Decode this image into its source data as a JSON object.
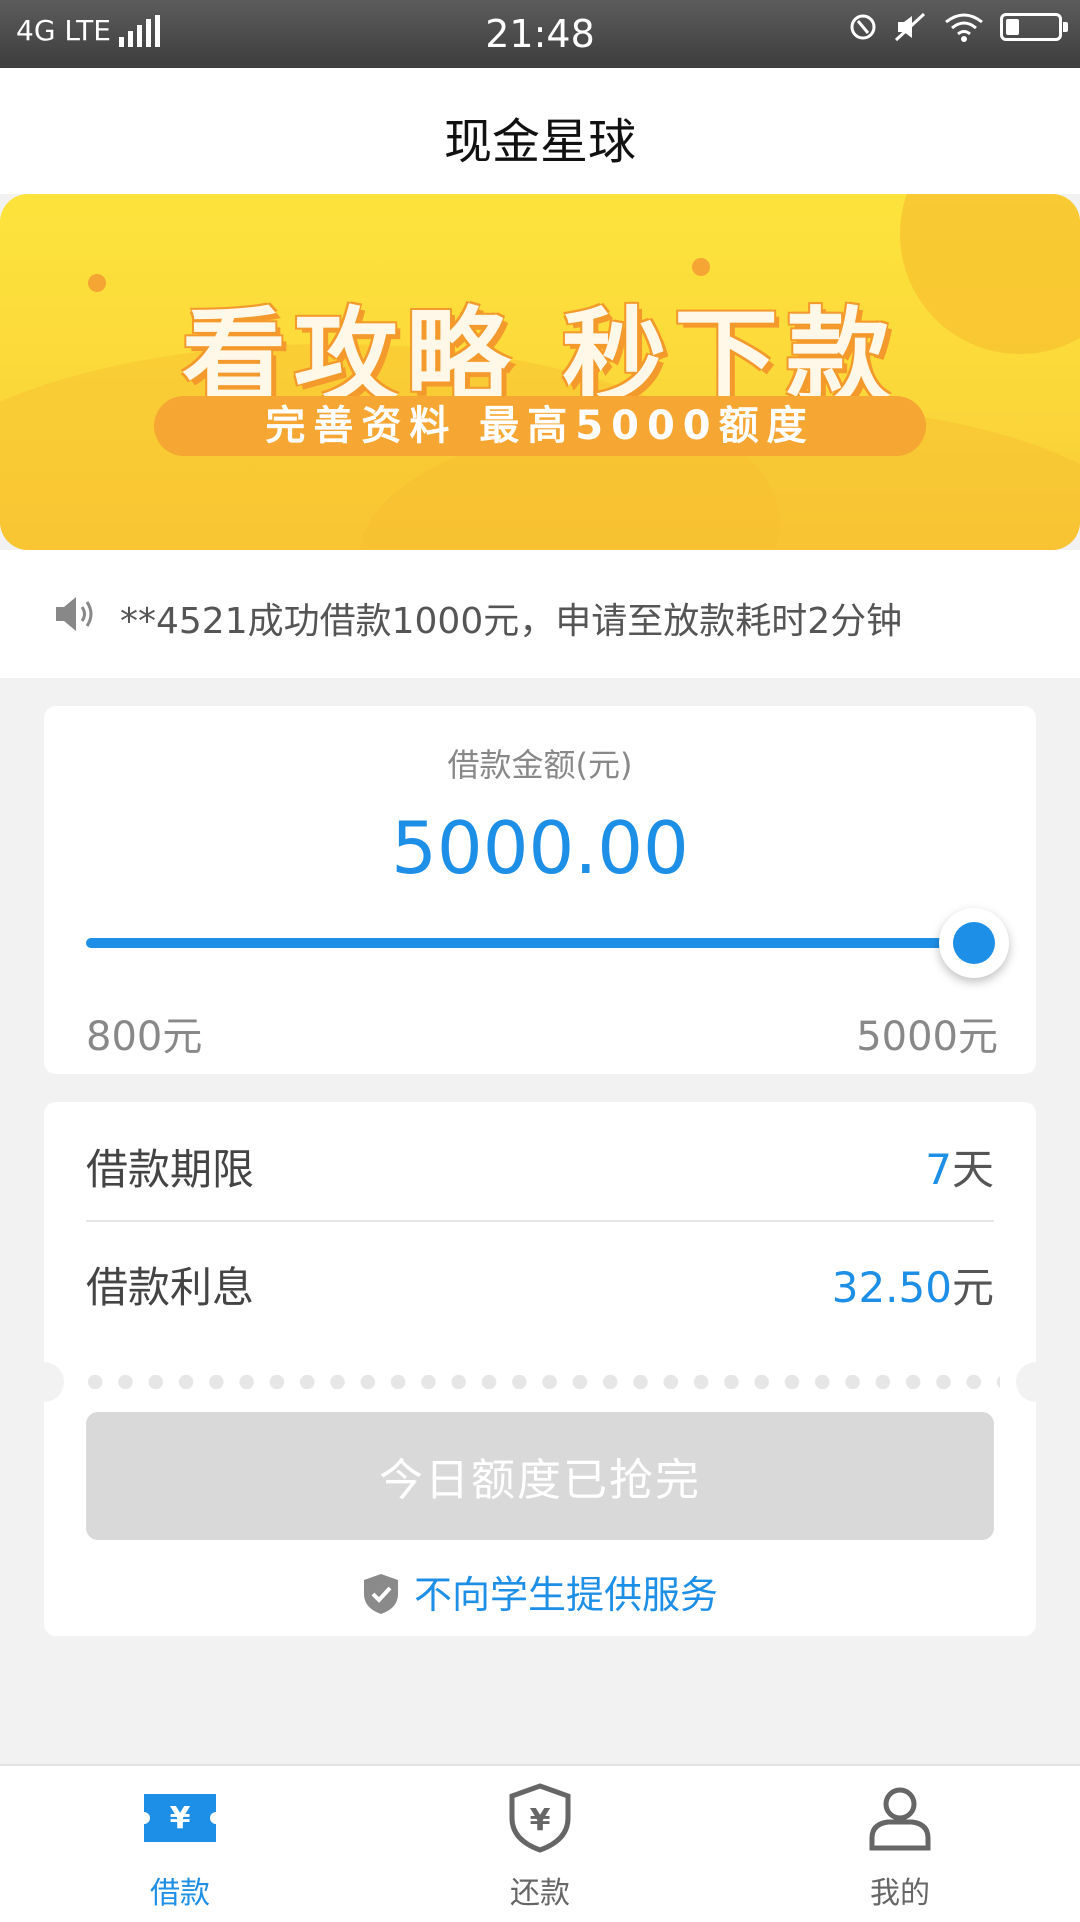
{
  "status_bar": {
    "network": "4G LTE",
    "time": "21:48",
    "battery_level": 0.25
  },
  "header": {
    "title": "现金星球"
  },
  "banner": {
    "headline": "看攻略  秒下款",
    "subline": "完善资料   最高5000额度",
    "colors": {
      "background": "#fbd73a",
      "accent": "#f5a633"
    }
  },
  "notice": {
    "text": "**4521成功借款1000元，申请至放款耗时2分钟"
  },
  "loan_amount": {
    "label": "借款金额(元)",
    "value": "5000.00",
    "slider": {
      "min": 800,
      "max": 5000,
      "current": 5000,
      "min_label": "800元",
      "max_label": "5000元"
    }
  },
  "loan_terms": {
    "period_label": "借款期限",
    "period_value": "7",
    "period_unit": "天",
    "interest_label": "借款利息",
    "interest_value": "32.50",
    "interest_unit": "元"
  },
  "action": {
    "button_label": "今日额度已抢完",
    "disabled": true
  },
  "student_note": "不向学生提供服务",
  "tabs": [
    {
      "label": "借款",
      "icon": "ticket-yen-icon",
      "active": true
    },
    {
      "label": "还款",
      "icon": "shield-yen-icon",
      "active": false
    },
    {
      "label": "我的",
      "icon": "user-icon",
      "active": false
    }
  ],
  "colors": {
    "accent": "#1e8fe6",
    "disabled": "#d9d9d9",
    "text_gray": "#888888"
  }
}
